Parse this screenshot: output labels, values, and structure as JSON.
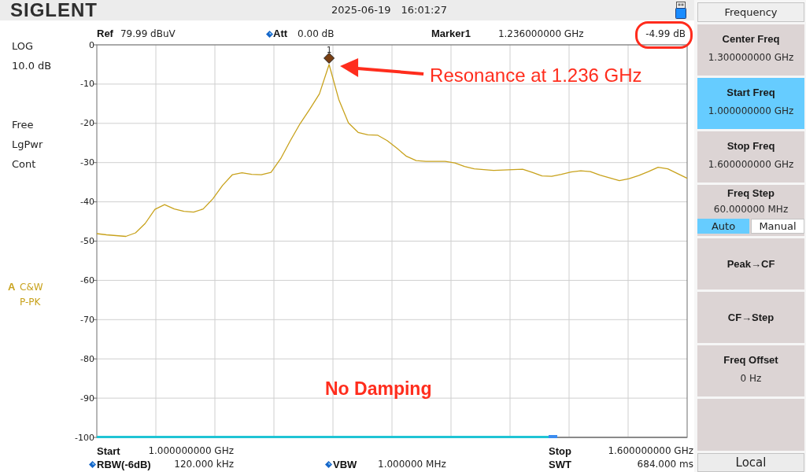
{
  "top_bar": {
    "logo": "SIGLENT",
    "date": "2025-06-19",
    "time": "16:01:27"
  },
  "info_line": {
    "ref": {
      "label": "Ref",
      "value": "79.99 dBuV",
      "marked": false
    },
    "att": {
      "label": "Att",
      "value": "0.00 dB",
      "marked": true
    },
    "marker": {
      "label": "Marker1",
      "frequency": "1.236000000 GHz",
      "amplitude": "-4.99 dB",
      "highlighted": true
    }
  },
  "left_panel": {
    "scale": [
      "LOG",
      "10.0 dB"
    ],
    "settings": [
      "Free",
      "LgPwr",
      "Cont"
    ],
    "trace": {
      "name": "A",
      "mode": "C&W",
      "detector": "P-PK"
    }
  },
  "chart": {
    "marker_label": "1",
    "callout": "Resonance at 1.236 GHz",
    "note": "No Damping",
    "sweep": {
      "level": 0.78
    },
    "chart_data": {
      "type": "line",
      "grid": true,
      "categories": [
        null,
        null,
        null,
        null,
        null,
        null,
        null,
        null,
        null,
        null,
        null,
        null,
        null,
        null,
        null,
        null,
        null,
        null,
        null,
        null,
        null,
        null,
        null,
        null,
        null,
        null,
        null,
        null,
        null,
        null,
        null,
        null,
        null,
        null,
        null,
        null,
        null,
        null,
        null,
        null,
        null,
        null,
        null,
        null,
        null,
        null,
        null,
        null,
        null,
        null,
        null,
        null,
        null,
        null,
        null,
        null,
        null,
        null,
        null,
        null,
        null,
        null
      ],
      "series": [
        {
          "color": "#c8a21c",
          "values": [
            -48.1,
            -48.4,
            -48.6,
            -48.8,
            -47.9,
            -45.5,
            -41.9,
            -40.7,
            -41.8,
            -42.4,
            -42.6,
            -41.8,
            -39.2,
            -35.8,
            -33.1,
            -32.6,
            -33.0,
            -33.1,
            -32.5,
            -29.0,
            -24.4,
            -20.1,
            -16.4,
            -12.5,
            -5.0,
            -13.9,
            -19.9,
            -22.3,
            -22.9,
            -23.0,
            -24.4,
            -26.3,
            -28.4,
            -29.5,
            -29.7,
            -29.7,
            -29.7,
            -30.1,
            -31.0,
            -31.6,
            -31.8,
            -32.0,
            -31.9,
            -31.8,
            -31.7,
            -32.5,
            -33.4,
            -33.5,
            -33.0,
            -32.4,
            -32.1,
            -32.3,
            -33.2,
            -33.9,
            -34.6,
            -34.1,
            -33.3,
            -32.3,
            -31.2,
            -31.6,
            -32.8,
            -34.0
          ]
        }
      ],
      "ylim": [
        -100,
        0
      ],
      "yticks": [
        0,
        -10,
        -20,
        -30,
        -40,
        -50,
        -60,
        -70,
        -80,
        -90,
        -100
      ]
    }
  },
  "bottom_rows": [
    {
      "left": {
        "label": "Start",
        "value": "1.000000000 GHz",
        "marked": false
      },
      "right": {
        "label": "Stop",
        "value": "1.600000000 GHz",
        "marked": false
      }
    },
    {
      "left": {
        "label": "RBW(-6dB)",
        "value": "120.000 kHz",
        "marked": true
      },
      "middle": {
        "label": "VBW",
        "value": "1.000000 MHz",
        "marked": true
      },
      "right": {
        "label": "SWT",
        "value": "684.000 ms",
        "marked": false
      }
    }
  ],
  "softkey_panel": {
    "title": "Frequency",
    "keys": [
      {
        "kind": "value",
        "label": "Center Freq",
        "value": "1.300000000 GHz",
        "selected": false
      },
      {
        "kind": "value",
        "label": "Start Freq",
        "value": "1.000000000 GHz",
        "selected": true
      },
      {
        "kind": "value",
        "label": "Stop Freq",
        "value": "1.600000000 GHz",
        "selected": false
      },
      {
        "kind": "toggle",
        "label": "Freq Step",
        "value": "60.000000 MHz",
        "selected": false,
        "options": [
          {
            "label": "Auto",
            "selected": true
          },
          {
            "label": "Manual",
            "selected": false
          }
        ]
      },
      {
        "kind": "action",
        "label": "Peak→CF",
        "selected": false
      },
      {
        "kind": "action",
        "label": "CF→Step",
        "selected": false
      },
      {
        "kind": "value",
        "label": "Freq Offset",
        "value": "0 Hz",
        "selected": false
      },
      {
        "kind": "blank",
        "selected": false
      }
    ],
    "footer": "Local"
  }
}
